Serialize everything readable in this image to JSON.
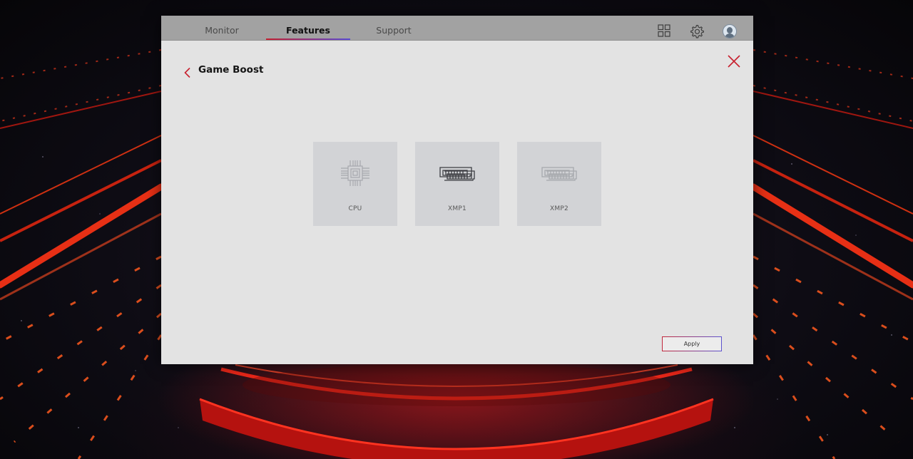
{
  "tabs": [
    {
      "label": "Monitor",
      "active": false
    },
    {
      "label": "Features",
      "active": true
    },
    {
      "label": "Support",
      "active": false
    }
  ],
  "toolbar": {
    "icons": [
      "grid-icon",
      "gear-icon",
      "user-avatar"
    ]
  },
  "page": {
    "title": "Game Boost"
  },
  "options": [
    {
      "label": "CPU",
      "icon": "cpu-icon",
      "enabled": false
    },
    {
      "label": "XMP1",
      "icon": "memory-module-icon",
      "enabled": true
    },
    {
      "label": "XMP2",
      "icon": "memory-module-icon",
      "enabled": false
    }
  ],
  "actions": {
    "apply_label": "Apply"
  },
  "colors": {
    "accent_red": "#c51f30",
    "accent_purple": "#5b4bd6",
    "window_bg": "#e3e3e3",
    "topbar_bg": "#a2a2a2",
    "card_bg": "#d2d3d6"
  }
}
